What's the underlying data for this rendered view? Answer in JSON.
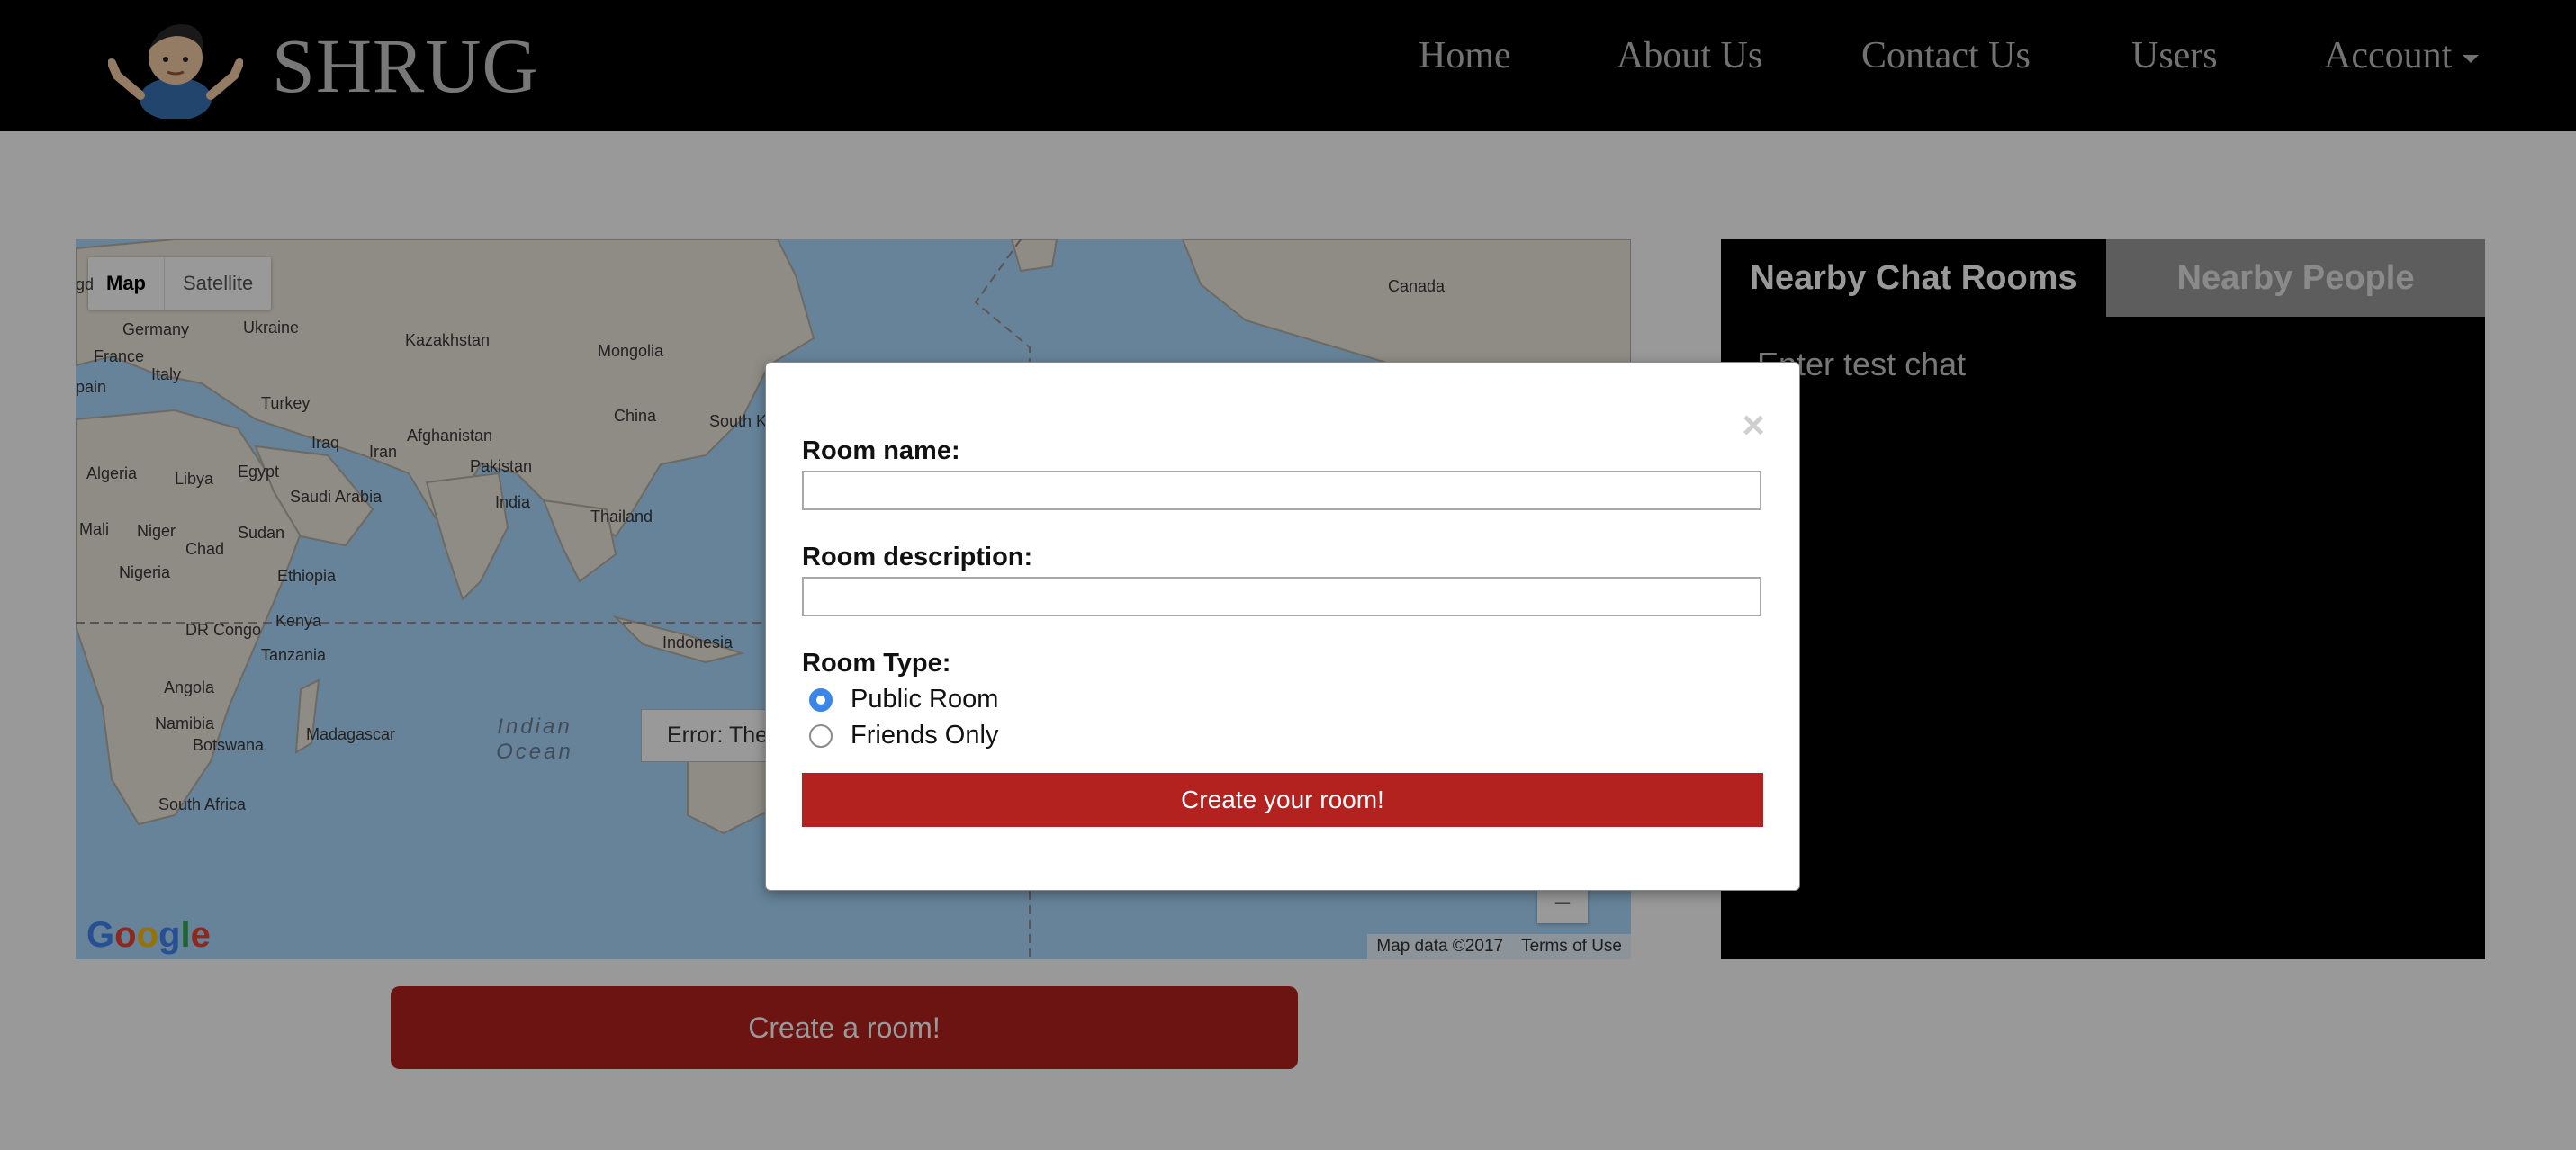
{
  "navbar": {
    "brand": "SHRUG",
    "items": [
      {
        "label": "Home"
      },
      {
        "label": "About Us"
      },
      {
        "label": "Contact Us"
      },
      {
        "label": "Users"
      },
      {
        "label": "Account"
      }
    ]
  },
  "map": {
    "type_buttons": [
      "Map",
      "Satellite"
    ],
    "active_type": "Map",
    "labels": {
      "germany": "Germany",
      "ukraine": "Ukraine",
      "kazakhstan": "Kazakhstan",
      "mongolia": "Mongolia",
      "canada": "Canada",
      "france": "France",
      "italy": "Italy",
      "spain": "pain",
      "turkey": "Turkey",
      "afghanistan": "Afghanistan",
      "china": "China",
      "south": "South K",
      "iraq": "Iraq",
      "iran": "Iran",
      "pakistan": "Pakistan",
      "algeria": "Algeria",
      "libya": "Libya",
      "egypt": "Egypt",
      "saudi": "Saudi Arabia",
      "india": "India",
      "thailand": "Thailand",
      "mali": "Mali",
      "niger": "Niger",
      "chad": "Chad",
      "sudan": "Sudan",
      "nigeria": "Nigeria",
      "ethiopia": "Ethiopia",
      "drc": "DR Congo",
      "kenya": "Kenya",
      "indonesia": "Indonesia",
      "tanzania": "Tanzania",
      "angola": "Angola",
      "namibia": "Namibia",
      "botswana": "Botswana",
      "madagascar": "Madagascar",
      "south_africa": "South Africa",
      "gd": "gd"
    },
    "ocean_label": "Indian Ocean",
    "error_text": "Error: The",
    "google": "Google",
    "footer": [
      "Map data ©2017",
      "Terms of Use"
    ],
    "zoom_out": "−"
  },
  "sidebar": {
    "tabs": [
      "Nearby Chat Rooms",
      "Nearby People"
    ],
    "active_tab": "Nearby Chat Rooms",
    "rooms": [
      {
        "name": "Enter test chat"
      }
    ]
  },
  "create_room_button": "Create a room!",
  "modal": {
    "close": "×",
    "room_name_label": "Room name:",
    "room_name_value": "",
    "room_description_label": "Room description:",
    "room_description_value": "",
    "room_type_label": "Room Type:",
    "room_types": [
      {
        "label": "Public Room",
        "selected": true
      },
      {
        "label": "Friends Only",
        "selected": false
      }
    ],
    "submit_label": "Create your room!"
  },
  "colors": {
    "accent": "#b3221f",
    "navbar": "#000000",
    "radio_selected": "#3b86e8"
  }
}
